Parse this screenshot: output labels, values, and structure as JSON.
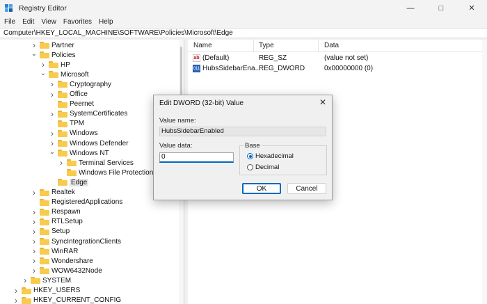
{
  "window": {
    "title": "Registry Editor",
    "min_icon": "minimize-icon",
    "max_icon": "maximize-icon",
    "close_icon": "close-icon"
  },
  "menu": [
    "File",
    "Edit",
    "View",
    "Favorites",
    "Help"
  ],
  "address": "Computer\\HKEY_LOCAL_MACHINE\\SOFTWARE\\Policies\\Microsoft\\Edge",
  "tree": [
    {
      "label": "Partner",
      "level": 4,
      "chevron": ">"
    },
    {
      "label": "Policies",
      "level": 4,
      "chevron": "v"
    },
    {
      "label": "HP",
      "level": 5,
      "chevron": ">"
    },
    {
      "label": "Microsoft",
      "level": 5,
      "chevron": "v"
    },
    {
      "label": "Cryptography",
      "level": 6,
      "chevron": ">"
    },
    {
      "label": "Office",
      "level": 6,
      "chevron": ">"
    },
    {
      "label": "Peernet",
      "level": 6,
      "chevron": ""
    },
    {
      "label": "SystemCertificates",
      "level": 6,
      "chevron": ">"
    },
    {
      "label": "TPM",
      "level": 6,
      "chevron": ""
    },
    {
      "label": "Windows",
      "level": 6,
      "chevron": ">"
    },
    {
      "label": "Windows Defender",
      "level": 6,
      "chevron": ">"
    },
    {
      "label": "Windows NT",
      "level": 6,
      "chevron": "v"
    },
    {
      "label": "Terminal Services",
      "level": 7,
      "chevron": ">"
    },
    {
      "label": "Windows File Protection",
      "level": 7,
      "chevron": ""
    },
    {
      "label": "Edge",
      "level": 6,
      "chevron": "",
      "selected": true
    },
    {
      "label": "Realtek",
      "level": 4,
      "chevron": ">"
    },
    {
      "label": "RegisteredApplications",
      "level": 4,
      "chevron": ""
    },
    {
      "label": "Respawn",
      "level": 4,
      "chevron": ">"
    },
    {
      "label": "RTLSetup",
      "level": 4,
      "chevron": ">"
    },
    {
      "label": "Setup",
      "level": 4,
      "chevron": ">"
    },
    {
      "label": "SyncIntegrationClients",
      "level": 4,
      "chevron": ">"
    },
    {
      "label": "WinRAR",
      "level": 4,
      "chevron": ">"
    },
    {
      "label": "Wondershare",
      "level": 4,
      "chevron": ">"
    },
    {
      "label": "WOW6432Node",
      "level": 4,
      "chevron": ">"
    },
    {
      "label": "SYSTEM",
      "level": 3,
      "chevron": ">"
    },
    {
      "label": "HKEY_USERS",
      "level": 2,
      "chevron": ">"
    },
    {
      "label": "HKEY_CURRENT_CONFIG",
      "level": 2,
      "chevron": ">"
    }
  ],
  "list": {
    "columns": [
      "Name",
      "Type",
      "Data"
    ],
    "rows": [
      {
        "name": "(Default)",
        "type": "REG_SZ",
        "data": "(value not set)",
        "icon": "string-value-icon",
        "icon_text": "ab"
      },
      {
        "name": "HubsSidebarEna...",
        "type": "REG_DWORD",
        "data": "0x00000000 (0)",
        "icon": "binary-value-icon",
        "icon_text": "011"
      }
    ]
  },
  "dialog": {
    "title": "Edit DWORD (32-bit) Value",
    "value_name_label": "Value name:",
    "value_name": "HubsSidebarEnabled",
    "value_data_label": "Value data:",
    "value_data": "0",
    "base_label": "Base",
    "hex_label": "Hexadecimal",
    "dec_label": "Decimal",
    "base_selected": "Hexadecimal",
    "ok_label": "OK",
    "cancel_label": "Cancel"
  },
  "colors": {
    "accent": "#0067c0",
    "folder": "#f7cb4d"
  }
}
